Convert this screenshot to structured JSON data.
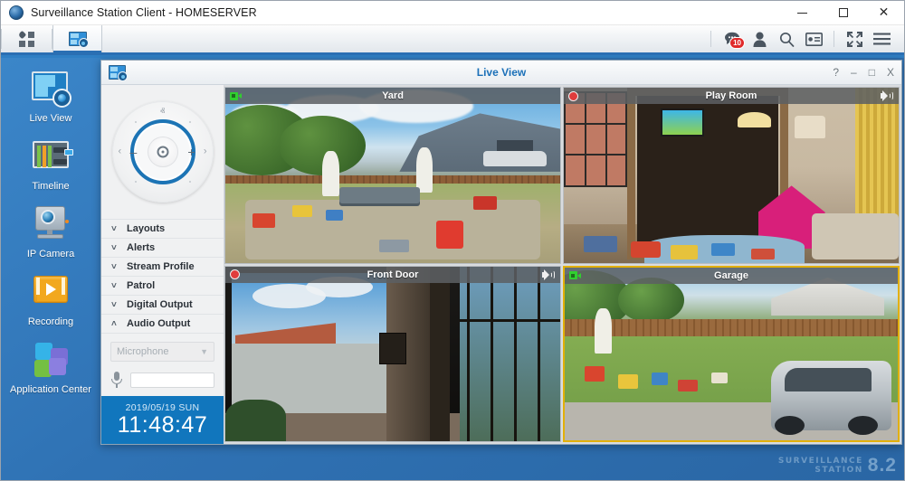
{
  "window": {
    "title": "Surveillance Station Client - HOMESERVER",
    "app_icon": "surveillance-station-icon",
    "controls": {
      "minimize": "minimize",
      "maximize": "maximize",
      "close": "close"
    }
  },
  "toolbar": {
    "apps_icon": "apps-grid-icon",
    "live_view_tab_icon": "live-view-icon",
    "right_icons": [
      {
        "name": "notifications-chat-icon",
        "badge": "10"
      },
      {
        "name": "user-account-icon",
        "badge": ""
      },
      {
        "name": "search-icon",
        "badge": ""
      },
      {
        "name": "license-card-icon",
        "badge": ""
      },
      {
        "name": "fullscreen-icon",
        "badge": ""
      },
      {
        "name": "hamburger-menu-icon",
        "badge": ""
      }
    ]
  },
  "sidebar": {
    "items": [
      {
        "label": "Live View",
        "icon": "live-view-icon"
      },
      {
        "label": "Timeline",
        "icon": "timeline-icon"
      },
      {
        "label": "IP Camera",
        "icon": "ip-camera-icon"
      },
      {
        "label": "Recording",
        "icon": "recording-icon"
      },
      {
        "label": "Application Center",
        "icon": "application-center-icon"
      }
    ]
  },
  "live_window": {
    "title": "Live View",
    "icon": "live-view-icon",
    "controls": {
      "help": "?",
      "minimize": "–",
      "maximize": "□",
      "close": "X"
    }
  },
  "control_panel": {
    "ptz": {
      "up": "ⱏ",
      "down": "ⱟ",
      "left": "‹",
      "right": "›",
      "zoom_out": "–",
      "zoom_in": "+",
      "home": "home-target-icon"
    },
    "sections": [
      {
        "label": "Layouts",
        "expanded": false
      },
      {
        "label": "Alerts",
        "expanded": false
      },
      {
        "label": "Stream Profile",
        "expanded": false
      },
      {
        "label": "Patrol",
        "expanded": false
      },
      {
        "label": "Digital Output",
        "expanded": false
      },
      {
        "label": "Audio Output",
        "expanded": true
      }
    ],
    "audio_output": {
      "device_placeholder": "Microphone",
      "device_value": "",
      "mic_icon": "microphone-icon",
      "volume": 0
    },
    "clock": {
      "date": "2019/05/19 SUN",
      "time": "11:48:47"
    }
  },
  "cameras": [
    {
      "name": "Yard",
      "status_icon": "camera-green-icon",
      "recording": false,
      "audio": false,
      "selected": false
    },
    {
      "name": "Play Room",
      "status_icon": "record-red-icon",
      "recording": true,
      "audio": true,
      "selected": false
    },
    {
      "name": "Front Door",
      "status_icon": "record-red-icon",
      "recording": true,
      "audio": true,
      "selected": false
    },
    {
      "name": "Garage",
      "status_icon": "camera-green-icon",
      "recording": false,
      "audio": false,
      "selected": true
    }
  ],
  "watermark": {
    "line1": "SURVEILLANCE",
    "line2": "STATION",
    "version": "8.2"
  },
  "colors": {
    "accent_blue": "#1176bd",
    "desktop_blue": "#2f72b4",
    "title_link": "#1b70b8",
    "selection_gold": "#e2b007",
    "record_red": "#e03c3c",
    "camera_green": "#31cf2f",
    "badge_red": "#e02a2a"
  }
}
